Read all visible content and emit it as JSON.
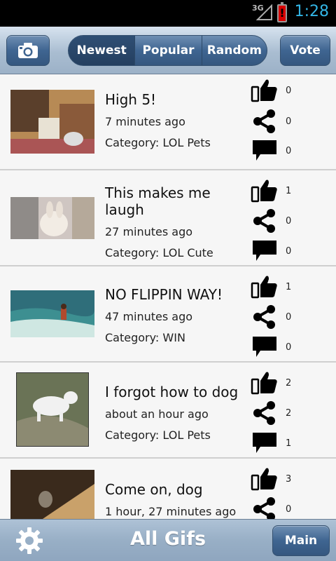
{
  "status_bar": {
    "network": "3G",
    "time": "1:28"
  },
  "toolbar": {
    "camera_icon": "camera-icon",
    "tabs": [
      {
        "label": "Newest",
        "active": true
      },
      {
        "label": "Popular",
        "active": false
      },
      {
        "label": "Random",
        "active": false
      }
    ],
    "vote_label": "Vote"
  },
  "gifs": [
    {
      "title": "High 5!",
      "time": "7 minutes ago",
      "category": "Category: LOL Pets",
      "likes": "0",
      "shares": "0",
      "comments": "0"
    },
    {
      "title": "This makes me laugh",
      "time": "27 minutes ago",
      "category": "Category: LOL Cute",
      "likes": "1",
      "shares": "0",
      "comments": "0"
    },
    {
      "title": "NO FLIPPIN WAY!",
      "time": "47 minutes ago",
      "category": "Category: WIN",
      "likes": "1",
      "shares": "0",
      "comments": "0"
    },
    {
      "title": "I forgot how to dog",
      "time": "about an hour ago",
      "category": "Category: LOL Pets",
      "likes": "2",
      "shares": "2",
      "comments": "1"
    },
    {
      "title": "Come on, dog",
      "time": "1 hour, 27 minutes ago",
      "category": "",
      "likes": "3",
      "shares": "0",
      "comments": ""
    }
  ],
  "bottom_bar": {
    "title": "All Gifs",
    "main_label": "Main",
    "settings_icon": "gear-icon"
  },
  "colors": {
    "accent": "#33b5e5",
    "button": "#3f6591",
    "toolbar": "#a9bdd1"
  }
}
